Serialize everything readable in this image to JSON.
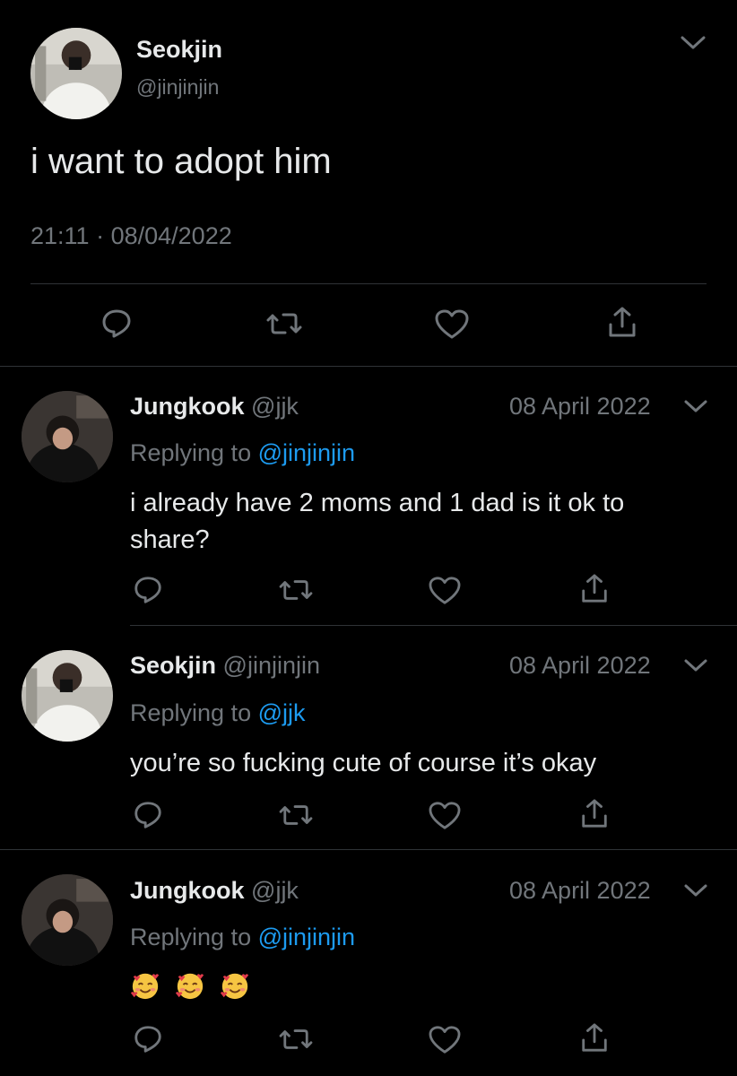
{
  "main_tweet": {
    "author_name": "Seokjin",
    "author_handle": "@jinjinjin",
    "text": "i want to adopt him",
    "time": "21:11",
    "dot": "·",
    "date": "08/04/2022"
  },
  "replies": [
    {
      "author_name": "Jungkook",
      "author_handle": "@jjk",
      "date": "08 April 2022",
      "replying_prefix": "Replying to",
      "replying_to": "@jinjinjin",
      "text_line1": "i already have 2 moms and 1 dad is it ok to",
      "text_line2": "share?"
    },
    {
      "author_name": "Seokjin",
      "author_handle": "@jinjinjin",
      "date": "08 April 2022",
      "replying_prefix": "Replying to",
      "replying_to": "@jjk",
      "text_line1": "you’re so fucking cute of course it’s okay"
    },
    {
      "author_name": "Jungkook",
      "author_handle": "@jjk",
      "date": "08 April 2022",
      "replying_prefix": "Replying to",
      "replying_to": "@jinjinjin",
      "emoji_count": 3,
      "emoji_name": "smiling-face-with-hearts"
    }
  ],
  "icons": [
    "reply-icon",
    "retweet-icon",
    "like-icon",
    "share-icon",
    "chevron-down-icon"
  ],
  "colors": {
    "background": "#000000",
    "text": "#e7e9ea",
    "muted": "#71767b",
    "link": "#1d9bf0",
    "divider": "#2f3336"
  }
}
